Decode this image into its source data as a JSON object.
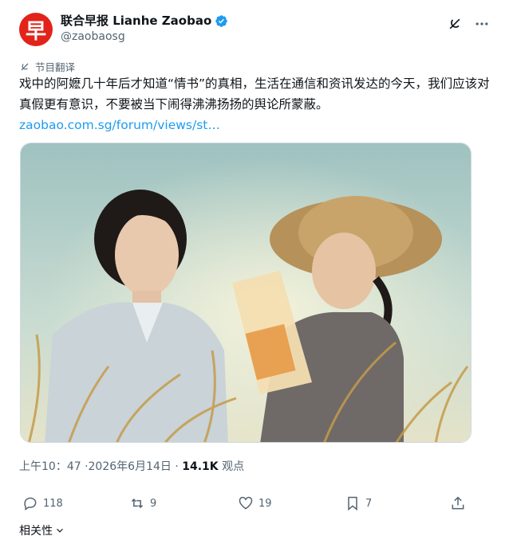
{
  "account": {
    "avatar_char": "早",
    "display_name": "联合早报 Lianhe Zaobao",
    "handle": "@zaobaosg"
  },
  "translate_label": "节目翻译",
  "tweet": {
    "text": "戏中的阿嬷几十年后才知道“情书”的真相，生活在通信和资讯发达的今天，我们应该对真假更有意识，不要被当下闹得沸沸扬扬的舆论所蒙蔽。",
    "link": "zaobao.com.sg/forum/views/st…"
  },
  "media": {
    "description_icon": "photo"
  },
  "meta": {
    "timestamp": "上午10：47 ·2026年6月14日 · ",
    "views_count": "14.1K",
    "views_label": " 观点"
  },
  "actions": {
    "replies": "118",
    "reposts": "9",
    "likes": "19",
    "bookmarks": "7"
  },
  "related_label": "相关性"
}
